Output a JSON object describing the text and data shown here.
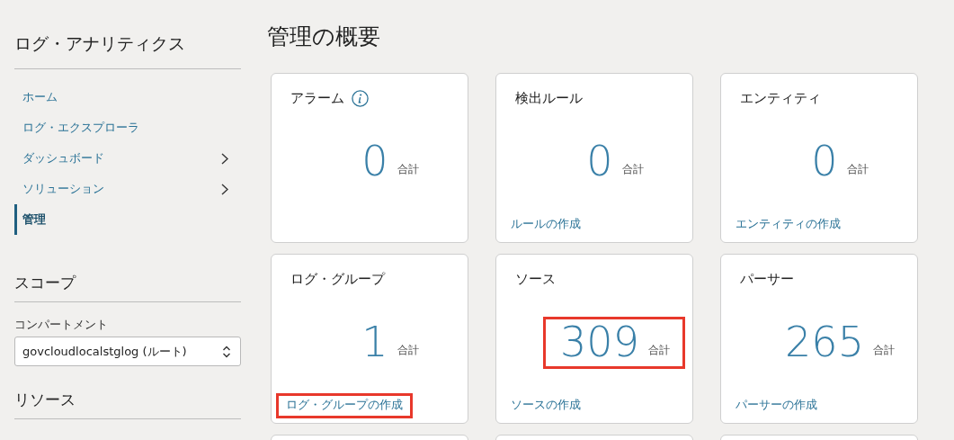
{
  "sidebar": {
    "title": "ログ・アナリティクス",
    "nav": [
      {
        "label": "ホーム",
        "selected": false,
        "has_submenu": false
      },
      {
        "label": "ログ・エクスプローラ",
        "selected": false,
        "has_submenu": false
      },
      {
        "label": "ダッシュボード",
        "selected": false,
        "has_submenu": true
      },
      {
        "label": "ソリューション",
        "selected": false,
        "has_submenu": true
      },
      {
        "label": "管理",
        "selected": true,
        "has_submenu": false
      }
    ],
    "scope": {
      "heading": "スコープ",
      "field_label": "コンパートメント",
      "value": "govcloudlocalstglog (ルート)"
    },
    "resources": {
      "heading": "リソース"
    }
  },
  "main": {
    "title": "管理の概要",
    "cards": [
      {
        "kind": "stat",
        "title": "アラーム",
        "info": true,
        "count": "0",
        "count_label": "合計",
        "count_highlighted": false
      },
      {
        "kind": "stat",
        "title": "検出ルール",
        "info": false,
        "count": "0",
        "count_label": "合計",
        "count_highlighted": false,
        "link": "ルールの作成",
        "link_highlighted": false
      },
      {
        "kind": "stat",
        "title": "エンティティ",
        "info": false,
        "count": "0",
        "count_label": "合計",
        "count_highlighted": false,
        "link": "エンティティの作成",
        "link_highlighted": false
      },
      {
        "kind": "stat",
        "title": "ログ・グループ",
        "info": false,
        "count": "1",
        "count_label": "合計",
        "count_highlighted": false,
        "link": "ログ・グループの作成",
        "link_highlighted": true
      },
      {
        "kind": "stat",
        "title": "ソース",
        "info": false,
        "count": "309",
        "count_label": "合計",
        "count_highlighted": true,
        "link": "ソースの作成",
        "link_highlighted": false
      },
      {
        "kind": "stat",
        "title": "パーサー",
        "info": false,
        "count": "265",
        "count_label": "合計",
        "count_highlighted": false,
        "link": "パーサーの作成",
        "link_highlighted": false
      },
      {
        "kind": "cut"
      },
      {
        "kind": "cut"
      },
      {
        "kind": "cut"
      }
    ]
  }
}
